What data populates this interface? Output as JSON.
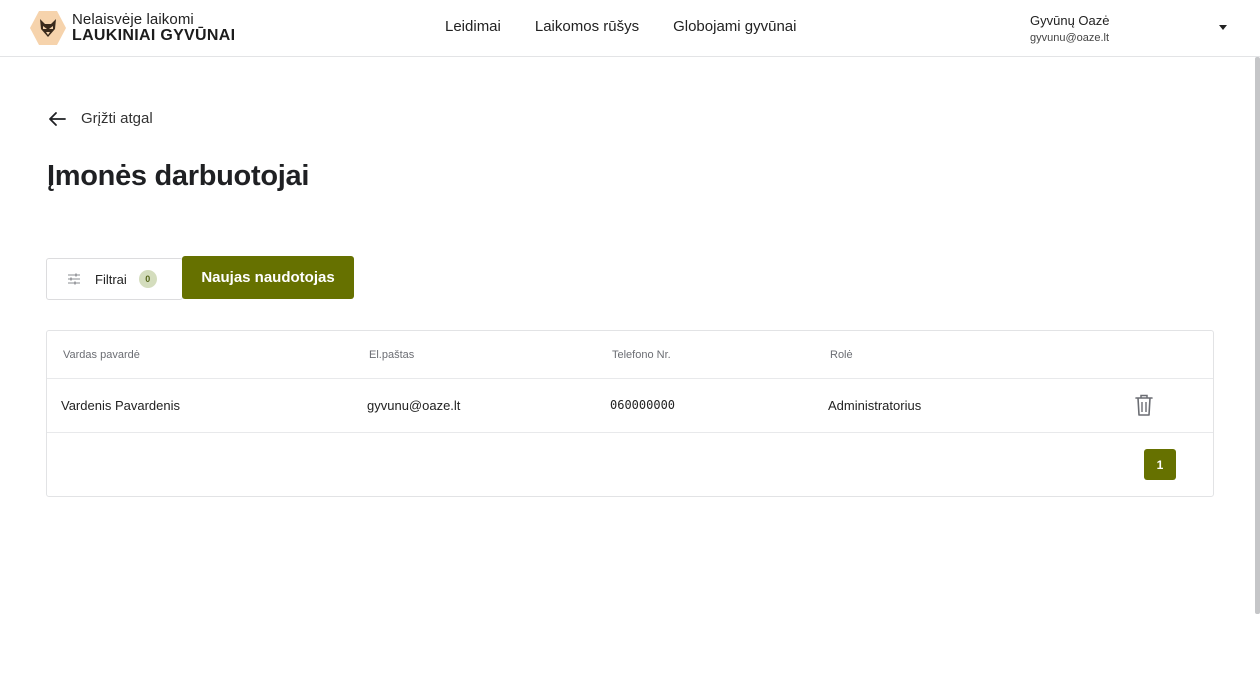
{
  "header": {
    "logo": {
      "line1": "Nelaisvėje laikomi",
      "line2": "LAUKINIAI GYVŪNAI",
      "icon": "fox-hexagon-icon"
    },
    "nav": [
      {
        "label": "Leidimai"
      },
      {
        "label": "Laikomos rūšys"
      },
      {
        "label": "Globojami gyvūnai"
      }
    ],
    "user": {
      "name": "Gyvūnų Oazė",
      "email": "gyvunu@oaze.lt"
    }
  },
  "back": {
    "label": "Grįžti atgal"
  },
  "page": {
    "title": "Įmonės darbuotojai"
  },
  "toolbar": {
    "filter_label": "Filtrai",
    "filter_count": "0",
    "new_user_label": "Naujas naudotojas"
  },
  "table": {
    "columns": [
      "Vardas pavardė",
      "El.paštas",
      "Telefono Nr.",
      "Rolė"
    ],
    "rows": [
      [
        "Vardenis Pavardenis",
        "gyvunu@oaze.lt",
        "060000000",
        "Administratorius"
      ]
    ]
  },
  "pagination": {
    "current": "1"
  },
  "colors": {
    "accent": "#667100",
    "badge_bg": "#d4ddbd",
    "logo_bg": "#f6d3ac"
  }
}
